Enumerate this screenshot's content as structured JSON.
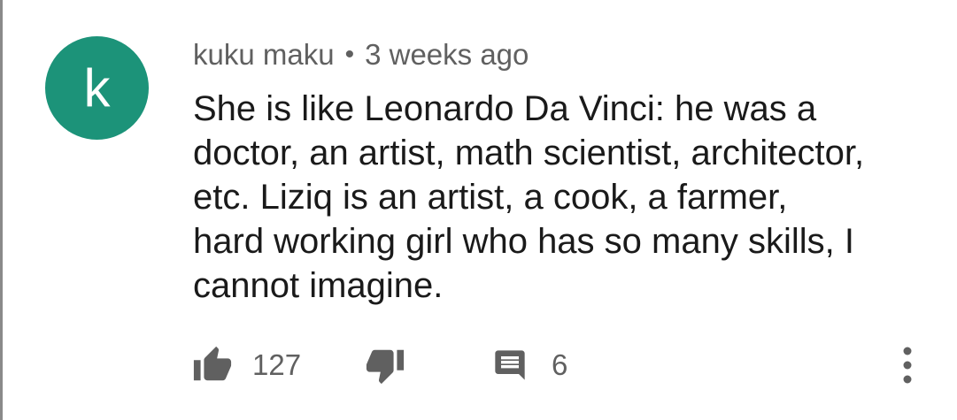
{
  "comment": {
    "avatar_letter": "k",
    "avatar_color": "#1c9379",
    "author": "kuku maku",
    "separator": "•",
    "time": "3 weeks ago",
    "text_lines": [
      "She is like Leonardo Da Vinci: he was a",
      "doctor, an artist, math scientist, architector,",
      "etc. Liziq is an artist, a cook, a farmer,",
      "hard working girl who has so many skills, I",
      "cannot imagine."
    ],
    "likes": "127",
    "replies": "6"
  },
  "icons": {
    "like": "thumbs-up-icon",
    "dislike": "thumbs-down-icon",
    "reply": "comment-icon",
    "more": "more-vertical-icon"
  },
  "colors": {
    "icon": "#606060",
    "meta_text": "#606060",
    "body_text": "#1a1a1a"
  }
}
